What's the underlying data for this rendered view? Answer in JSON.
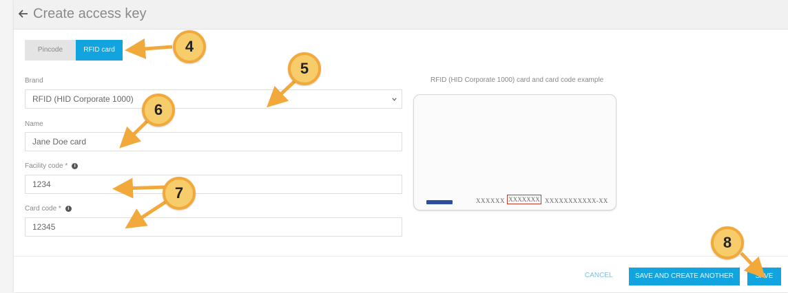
{
  "header": {
    "title": "Create access key",
    "back_icon": "arrow-left-icon"
  },
  "tabs": [
    {
      "label": "Pincode",
      "active": false
    },
    {
      "label": "RFID card",
      "active": true
    }
  ],
  "form": {
    "brand": {
      "label": "Brand",
      "value": "RFID (HID Corporate 1000)"
    },
    "name": {
      "label": "Name",
      "value": "Jane Doe card"
    },
    "facility_code": {
      "label": "Facility code *",
      "value": "1234"
    },
    "card_code": {
      "label": "Card code *",
      "value": "12345"
    }
  },
  "card_example": {
    "label": "RFID (HID Corporate 1000) card and card code example",
    "code_a": "XXXXXX",
    "code_b": "XXXXXXX",
    "code_c": "XXXXXXXXXXX-XX"
  },
  "footer": {
    "cancel_label": "CANCEL",
    "save_another_label": "SAVE AND CREATE ANOTHER",
    "save_label": "SAVE"
  },
  "callouts": {
    "c4": "4",
    "c5": "5",
    "c6": "6",
    "c7": "7",
    "c8": "8"
  },
  "colors": {
    "accent": "#12a4df",
    "callout_fill": "#f7cc6a",
    "callout_border": "#f2a93b",
    "highlight_box": "#c0392b"
  }
}
